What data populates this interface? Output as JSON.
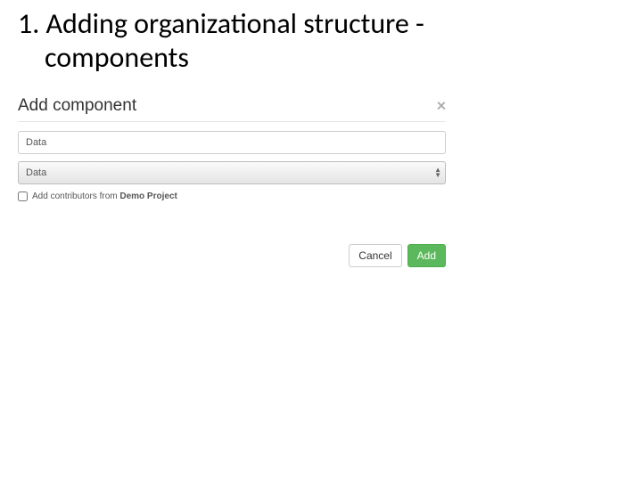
{
  "slide": {
    "title_line1": "1. Adding organizational structure -",
    "title_line2": "components"
  },
  "dialog": {
    "title": "Add component",
    "close_icon_glyph": "×",
    "name_input_value": "Data",
    "category_select_value": "Data",
    "checkbox_label_prefix": "Add contributors from ",
    "checkbox_label_project": "Demo Project",
    "cancel_label": "Cancel",
    "add_label": "Add"
  }
}
